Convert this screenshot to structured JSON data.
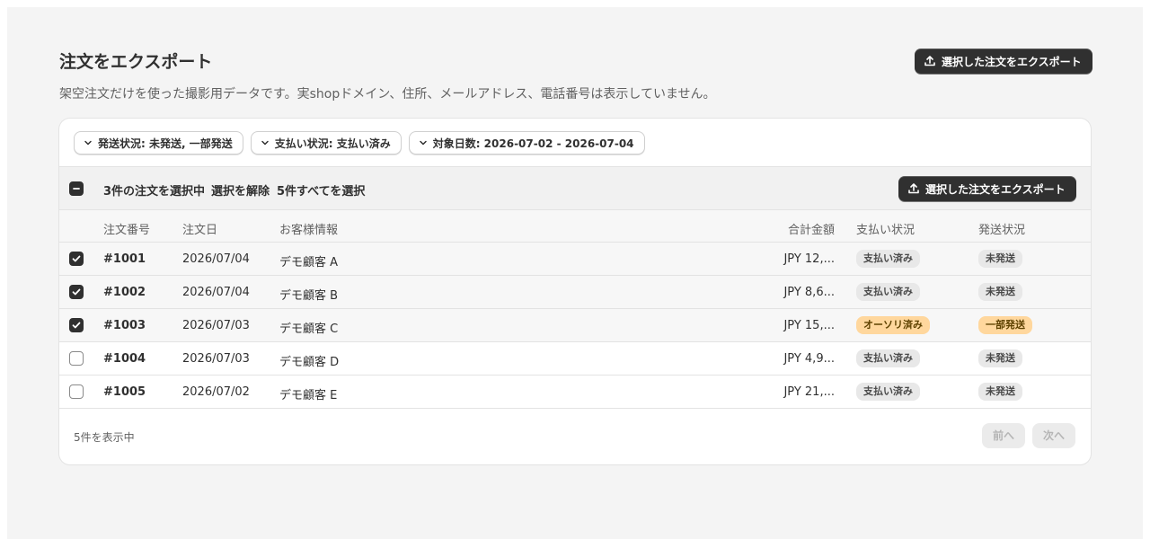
{
  "header": {
    "title": "注文をエクスポート",
    "subtitle": "架空注文だけを使った撮影用データです。実shopドメイン、住所、メールアドレス、電話番号は表示していません。",
    "export_button_label": "選択した注文をエクスポート",
    "export_icon": "upload-icon"
  },
  "filters": [
    {
      "label": "発送状況: 未発送, 一部発送",
      "icon": "chevron-down-icon"
    },
    {
      "label": "支払い状況: 支払い済み",
      "icon": "chevron-down-icon"
    },
    {
      "label": "対象日数: 2026-07-02 - 2026-07-04",
      "icon": "chevron-down-icon"
    }
  ],
  "bulk": {
    "selected_text": "3件の注文を選択中",
    "deselect_label": "選択を解除",
    "select_all_label": "5件すべてを選択",
    "export_button_label": "選択した注文をエクスポート"
  },
  "columns": {
    "order_number": "注文番号",
    "order_date": "注文日",
    "customer": "お客様情報",
    "total": "合計金額",
    "payment_status": "支払い状況",
    "fulfillment_status": "発送状況"
  },
  "rows": [
    {
      "selected": true,
      "order": "#1001",
      "date": "2026/07/04",
      "customer": "デモ顧客 A",
      "total": "JPY 12,...",
      "payment": "支払い済み",
      "payment_tone": "neutral",
      "fulfillment": "未発送",
      "fulfillment_tone": "neutral"
    },
    {
      "selected": true,
      "order": "#1002",
      "date": "2026/07/04",
      "customer": "デモ顧客 B",
      "total": "JPY 8,6...",
      "payment": "支払い済み",
      "payment_tone": "neutral",
      "fulfillment": "未発送",
      "fulfillment_tone": "neutral"
    },
    {
      "selected": true,
      "order": "#1003",
      "date": "2026/07/03",
      "customer": "デモ顧客 C",
      "total": "JPY 15,...",
      "payment": "オーソリ済み",
      "payment_tone": "warning",
      "fulfillment": "一部発送",
      "fulfillment_tone": "warning"
    },
    {
      "selected": false,
      "order": "#1004",
      "date": "2026/07/03",
      "customer": "デモ顧客 D",
      "total": "JPY 4,9...",
      "payment": "支払い済み",
      "payment_tone": "neutral",
      "fulfillment": "未発送",
      "fulfillment_tone": "neutral"
    },
    {
      "selected": false,
      "order": "#1005",
      "date": "2026/07/02",
      "customer": "デモ顧客 E",
      "total": "JPY 21,...",
      "payment": "支払い済み",
      "payment_tone": "neutral",
      "fulfillment": "未発送",
      "fulfillment_tone": "neutral"
    }
  ],
  "footer": {
    "count_text": "5件を表示中",
    "prev_label": "前へ",
    "next_label": "次へ"
  },
  "colors": {
    "primary_button": "#303030",
    "warning_badge": "#ffd79d",
    "neutral_badge": "#e8e8e8",
    "page_background": "#f4f4f4"
  }
}
